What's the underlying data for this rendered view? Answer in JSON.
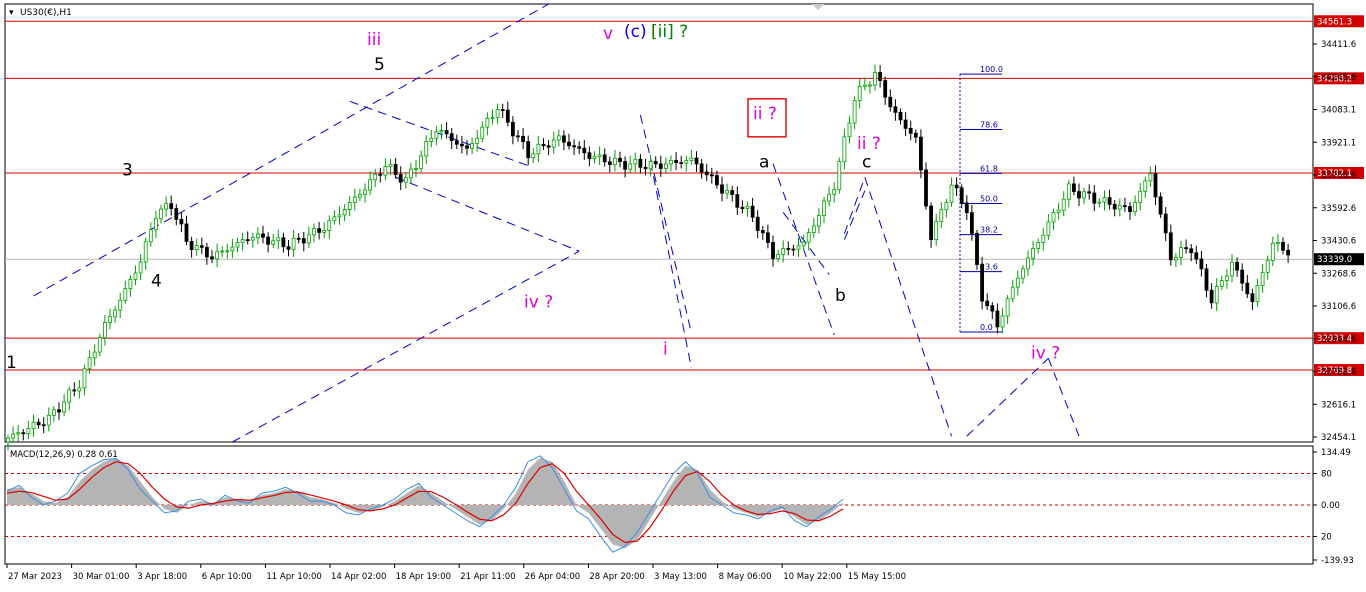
{
  "chart_title": "US30(€),H1",
  "colors": {
    "bull": "#00a000",
    "bear": "#000000",
    "hline": "#d00000",
    "trend": "#0000cc",
    "wave_magenta": "#dd00dd",
    "wave_black": "#000000",
    "wave_blue": "#0000ee",
    "wave_green": "#008000",
    "fib": "#0000a0",
    "macd_hist": "#b4b4b4",
    "macd_signal": "#dd0000",
    "macd_line": "#3a8ee6"
  },
  "chart_data": [
    {
      "type": "candlestick",
      "symbol": "US30(€)",
      "timeframe": "H1",
      "ylim": [
        32400,
        34650
      ],
      "price_axis_ticks": [
        "34411.6",
        "34245.6",
        "34083.1",
        "33921.1",
        "33755.6",
        "33592.6",
        "33430.6",
        "33268.6",
        "33106.6",
        "32944.6",
        "32782.6",
        "32616.1",
        "32454.1"
      ],
      "time_axis_ticks": [
        "27 Mar 2023",
        "30 Mar 01:00",
        "3 Apr 18:00",
        "6 Apr 10:00",
        "11 Apr 10:00",
        "14 Apr 02:00",
        "18 Apr 19:00",
        "21 Apr 11:00",
        "26 Apr 04:00",
        "28 Apr 20:00",
        "3 May 13:00",
        "8 May 06:00",
        "10 May 22:00",
        "15 May 15:00"
      ],
      "current_price": 33339.0,
      "current_price_label": "33339.0",
      "horizontal_levels": [
        {
          "value": 34561.3,
          "label": "34561.3"
        },
        {
          "value": 34268.2,
          "label": "34268.2"
        },
        {
          "value": 33782.1,
          "label": "33782.1"
        },
        {
          "value": 32933.4,
          "label": "32933.4"
        },
        {
          "value": 32769.8,
          "label": "32769.8"
        }
      ],
      "price_path": [
        [
          0,
          32420
        ],
        [
          8,
          32520
        ],
        [
          14,
          32700
        ],
        [
          19,
          33000
        ],
        [
          22,
          33130
        ],
        [
          26,
          33330
        ],
        [
          29,
          33570
        ],
        [
          32,
          33620
        ],
        [
          35,
          33430
        ],
        [
          40,
          33350
        ],
        [
          48,
          33460
        ],
        [
          55,
          33410
        ],
        [
          62,
          33500
        ],
        [
          68,
          33650
        ],
        [
          74,
          33820
        ],
        [
          78,
          33740
        ],
        [
          84,
          34010
        ],
        [
          90,
          33900
        ],
        [
          96,
          34120
        ],
        [
          102,
          33880
        ],
        [
          108,
          33960
        ],
        [
          114,
          33870
        ],
        [
          120,
          33830
        ],
        [
          127,
          33820
        ],
        [
          134,
          33850
        ],
        [
          140,
          33700
        ],
        [
          146,
          33560
        ],
        [
          150,
          33360
        ],
        [
          156,
          33420
        ],
        [
          162,
          33720
        ],
        [
          166,
          34170
        ],
        [
          170,
          34290
        ],
        [
          174,
          34080
        ],
        [
          178,
          33960
        ],
        [
          181,
          33450
        ],
        [
          185,
          33720
        ],
        [
          188,
          33600
        ],
        [
          191,
          33150
        ],
        [
          194,
          33000
        ],
        [
          198,
          33250
        ],
        [
          202,
          33430
        ],
        [
          208,
          33700
        ],
        [
          214,
          33640
        ],
        [
          220,
          33590
        ],
        [
          224,
          33780
        ],
        [
          228,
          33350
        ],
        [
          232,
          33400
        ],
        [
          236,
          33130
        ],
        [
          240,
          33320
        ],
        [
          244,
          33120
        ],
        [
          248,
          33420
        ],
        [
          251,
          33380
        ]
      ],
      "fibonacci": {
        "levels": [
          {
            "ratio": 100.0,
            "label": "100.0",
            "price": 34290
          },
          {
            "ratio": 78.6,
            "label": "78.6",
            "price": 34005
          },
          {
            "ratio": 61.8,
            "label": "61.8",
            "price": 33780
          },
          {
            "ratio": 50.0,
            "label": "50.0",
            "price": 33625
          },
          {
            "ratio": 38.2,
            "label": "38.2",
            "price": 33465
          },
          {
            "ratio": 23.6,
            "label": "23.6",
            "price": 33275
          },
          {
            "ratio": 0.0,
            "label": "0.0",
            "price": 32965
          }
        ]
      },
      "wave_labels": [
        {
          "id": "w1",
          "text": "1",
          "color": "black",
          "x": 2,
          "price": 32780
        },
        {
          "id": "w3",
          "text": "3",
          "color": "black",
          "x": 30,
          "price": 33770
        },
        {
          "id": "w4",
          "text": "4",
          "color": "black",
          "x": 39,
          "price": 33200
        },
        {
          "id": "w5",
          "text": "5",
          "color": "black",
          "x": 94,
          "price": 34310
        },
        {
          "id": "wiii",
          "text": "iii",
          "color": "magenta",
          "x": 92,
          "price": 34440
        },
        {
          "id": "wiv",
          "text": "iv ?",
          "color": "magenta",
          "x": 134,
          "price": 33090
        },
        {
          "id": "wv",
          "text": "v",
          "color": "magenta",
          "x": 152,
          "price": 34470
        },
        {
          "id": "wc",
          "text": "(c)",
          "color": "blue",
          "x": 159,
          "price": 34480
        },
        {
          "id": "wii_g",
          "text": "[ii] ?",
          "color": "green",
          "x": 167,
          "price": 34480
        },
        {
          "id": "wi",
          "text": "i",
          "color": "magenta",
          "x": 166,
          "price": 32850
        },
        {
          "id": "wii_box",
          "text": "ii ?",
          "color": "magenta",
          "x": 191,
          "price": 34060
        },
        {
          "id": "wa",
          "text": "a",
          "color": "black",
          "x": 191,
          "price": 33810
        },
        {
          "id": "wii2",
          "text": "ii ?",
          "color": "magenta",
          "x": 218,
          "price": 33905
        },
        {
          "id": "wc2",
          "text": "c",
          "color": "black",
          "x": 217,
          "price": 33810
        },
        {
          "id": "wb",
          "text": "b",
          "color": "black",
          "x": 210,
          "price": 33125
        },
        {
          "id": "wiv2",
          "text": "iv ?",
          "color": "magenta",
          "x": 260,
          "price": 32830
        }
      ]
    },
    {
      "type": "line",
      "indicator": "MACD(12,26,9)",
      "header": "MACD(12,26,9) 0.28 0.61",
      "main_value": 0.28,
      "signal_value": 0.61,
      "ylim": [
        -150,
        150
      ],
      "axis_ticks": [
        "134.49",
        "80",
        "0.00",
        "20",
        "-139.93"
      ],
      "levels": [
        80,
        0,
        -80
      ],
      "series": [
        {
          "key": "histogram",
          "values": [
            40,
            45,
            30,
            10,
            5,
            20,
            60,
            90,
            110,
            120,
            100,
            60,
            20,
            -10,
            -20,
            0,
            10,
            5,
            20,
            15,
            10,
            25,
            30,
            40,
            35,
            20,
            15,
            5,
            -10,
            -20,
            -15,
            -5,
            10,
            30,
            50,
            30,
            10,
            -10,
            -30,
            -50,
            -40,
            -10,
            30,
            90,
            120,
            110,
            60,
            0,
            -20,
            -60,
            -100,
            -110,
            -90,
            -40,
            10,
            60,
            100,
            90,
            40,
            10,
            -10,
            -20,
            -30,
            -20,
            -10,
            -30,
            -50,
            -40,
            -20,
            5
          ]
        },
        {
          "key": "signal",
          "values": [
            30,
            35,
            32,
            22,
            12,
            15,
            40,
            70,
            95,
            110,
            105,
            80,
            45,
            15,
            -5,
            -8,
            0,
            4,
            10,
            14,
            12,
            18,
            24,
            32,
            33,
            26,
            18,
            10,
            0,
            -12,
            -15,
            -10,
            0,
            18,
            35,
            34,
            20,
            2,
            -18,
            -36,
            -40,
            -25,
            5,
            55,
            95,
            105,
            80,
            35,
            0,
            -35,
            -75,
            -95,
            -92,
            -60,
            -15,
            35,
            75,
            85,
            60,
            25,
            0,
            -15,
            -24,
            -22,
            -15,
            -22,
            -38,
            -40,
            -28,
            -10
          ]
        },
        {
          "key": "macd",
          "values": [
            35,
            50,
            20,
            0,
            10,
            30,
            80,
            100,
            115,
            118,
            90,
            40,
            10,
            -20,
            -15,
            10,
            15,
            0,
            25,
            10,
            5,
            30,
            35,
            45,
            30,
            10,
            10,
            0,
            -20,
            -25,
            -10,
            0,
            15,
            40,
            55,
            20,
            0,
            -20,
            -40,
            -55,
            -30,
            0,
            45,
            110,
            125,
            95,
            40,
            -15,
            -35,
            -80,
            -120,
            -105,
            -70,
            -20,
            30,
            80,
            110,
            80,
            20,
            0,
            -20,
            -25,
            -35,
            -15,
            -5,
            -40,
            -55,
            -30,
            -10,
            15
          ]
        }
      ]
    }
  ]
}
